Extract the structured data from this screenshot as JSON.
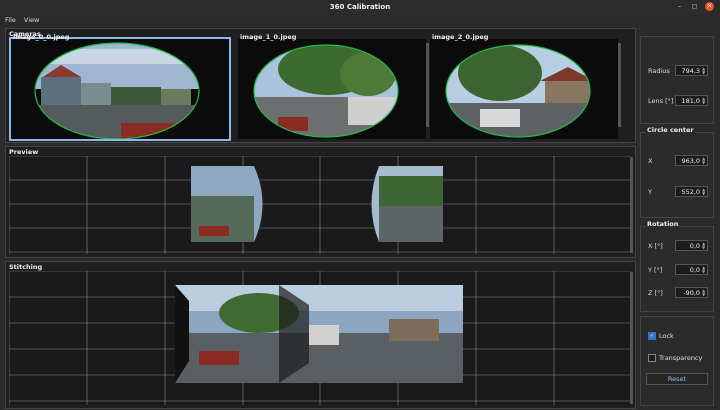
{
  "window": {
    "title": "360 Calibration"
  },
  "menu": {
    "file": "File",
    "view": "View"
  },
  "cameras": {
    "label": "Cameras",
    "items": [
      {
        "name": "image_0_0.jpeg"
      },
      {
        "name": "image_1_0.jpeg"
      },
      {
        "name": "image_2_0.jpeg"
      }
    ]
  },
  "preview": {
    "label": "Preview"
  },
  "stitching": {
    "label": "Stitching"
  },
  "lens_panel": {
    "radius_label": "Radius",
    "radius_value": "794,3",
    "lens_label": "Lens [°]",
    "lens_value": "181,0"
  },
  "circle_center": {
    "label": "Circle center",
    "x_label": "X",
    "x_value": "963,0",
    "y_label": "Y",
    "y_value": "552,0"
  },
  "rotation": {
    "label": "Rotation",
    "x_label": "X [°]",
    "x_value": "0,0",
    "y_label": "Y [°]",
    "y_value": "0,0",
    "z_label": "Z [°]",
    "z_value": "-90,0"
  },
  "options": {
    "lock_label": "Lock",
    "lock_checked": true,
    "transparency_label": "Transparency",
    "transparency_checked": false,
    "reset_label": "Reset"
  },
  "colors": {
    "accent": "#3574c4",
    "selected_border": "#8fb8e8",
    "circle": "#1fbf4a",
    "close": "#e95420"
  }
}
